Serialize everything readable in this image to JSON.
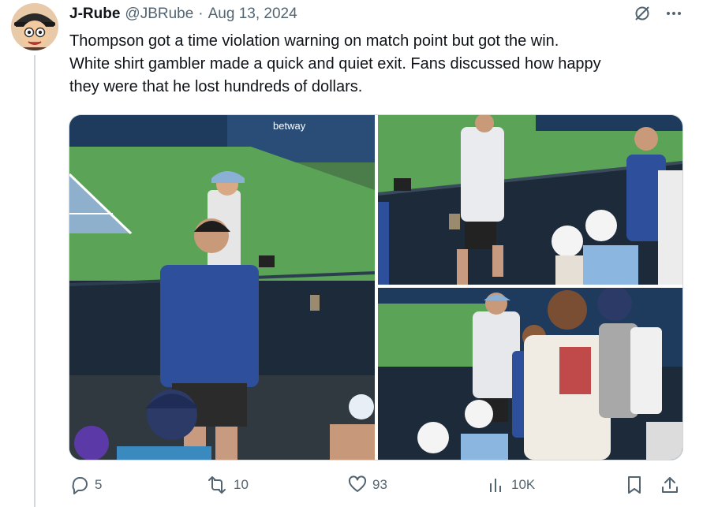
{
  "author": {
    "name": "J-Rube",
    "handle": "@JBRube",
    "separator": "·",
    "date": "Aug 13, 2024"
  },
  "tweet": {
    "lines": [
      "Thompson got a time violation warning on match point but got the win.",
      "White shirt gambler made a quick and quiet exit. Fans discussed how happy",
      "they were that he lost hundreds of dollars."
    ]
  },
  "media": {
    "photo_count": 3,
    "sponsor_banner": "betway",
    "icons": [
      "tennis-photo-1",
      "tennis-photo-2",
      "tennis-photo-3"
    ]
  },
  "stats": {
    "replies": "5",
    "reposts": "10",
    "likes": "93",
    "views": "10K"
  },
  "icons": {
    "top": [
      "grok-icon",
      "more-icon"
    ],
    "actions": [
      "reply-icon",
      "repost-icon",
      "like-icon",
      "views-icon",
      "bookmark-icon",
      "share-icon"
    ]
  },
  "colors": {
    "text": "#0f1419",
    "secondary": "#536471",
    "border": "#cfd9de",
    "court": "#4e9a4e",
    "wall": "#1f3a5a"
  }
}
